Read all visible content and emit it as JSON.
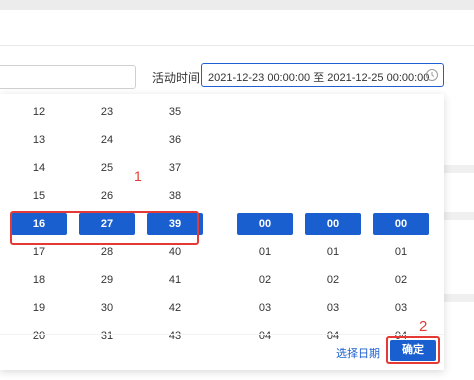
{
  "filter": {
    "label": "活动时间",
    "range_value": "2021-12-23 00:00:00 至 2021-12-25 00:00:00",
    "clock_icon": "clock-icon"
  },
  "picker": {
    "date_columns": [
      {
        "name": "day-column",
        "items": [
          "12",
          "13",
          "14",
          "15",
          "16",
          "17",
          "18",
          "19",
          "20"
        ],
        "selected": "16"
      },
      {
        "name": "hour-column",
        "items": [
          "23",
          "24",
          "25",
          "26",
          "27",
          "28",
          "29",
          "30",
          "31"
        ],
        "selected": "27"
      },
      {
        "name": "minute-column",
        "items": [
          "35",
          "36",
          "37",
          "38",
          "39",
          "40",
          "41",
          "42",
          "43"
        ],
        "selected": "39"
      }
    ],
    "time_columns": [
      {
        "name": "time-hour-column",
        "items": [
          "00",
          "01",
          "02",
          "03",
          "04"
        ],
        "selected": "00"
      },
      {
        "name": "time-minute-column",
        "items": [
          "00",
          "01",
          "02",
          "03",
          "04"
        ],
        "selected": "00"
      },
      {
        "name": "time-second-column",
        "items": [
          "00",
          "01",
          "02",
          "03",
          "04"
        ],
        "selected": "00"
      }
    ],
    "choose_date_label": "选择日期",
    "confirm_label": "确定"
  },
  "annotations": {
    "label_1": "1",
    "label_2": "2",
    "color": "#e53935"
  },
  "colors": {
    "accent": "#1a5fd0",
    "selected_text": "#ffffff"
  }
}
